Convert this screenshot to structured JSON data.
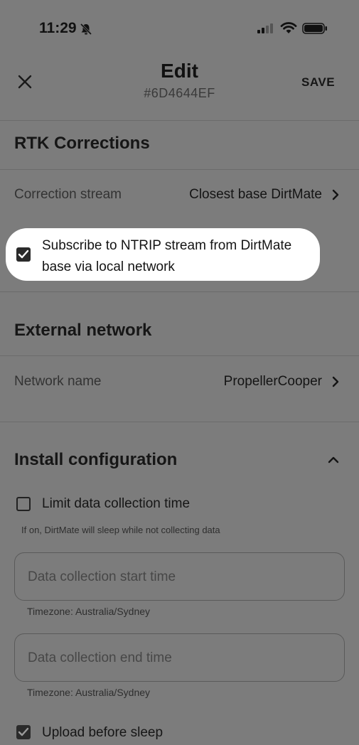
{
  "status_bar": {
    "time": "11:29"
  },
  "header": {
    "title": "Edit",
    "subtitle": "#6D4644EF",
    "save_label": "SAVE"
  },
  "rtk": {
    "section_title": "RTK Corrections",
    "correction_stream_label": "Correction stream",
    "correction_stream_value": "Closest base DirtMate",
    "subscribe_label": "Subscribe to NTRIP stream from DirtMate base via local network",
    "subscribe_checked": true
  },
  "external_network": {
    "section_title": "External network",
    "network_name_label": "Network name",
    "network_name_value": "PropellerCooper"
  },
  "install": {
    "section_title": "Install configuration",
    "limit_label": "Limit data collection time",
    "limit_checked": false,
    "limit_helper": "If on, DirtMate will sleep while not collecting data",
    "start_placeholder": "Data collection start time",
    "start_helper": "Timezone: Australia/Sydney",
    "end_placeholder": "Data collection end time",
    "end_helper": "Timezone: Australia/Sydney",
    "upload_label": "Upload before sleep",
    "upload_checked": true
  },
  "colors": {
    "overlay_background": "#7c7c7c",
    "highlight": "#ffffff"
  }
}
